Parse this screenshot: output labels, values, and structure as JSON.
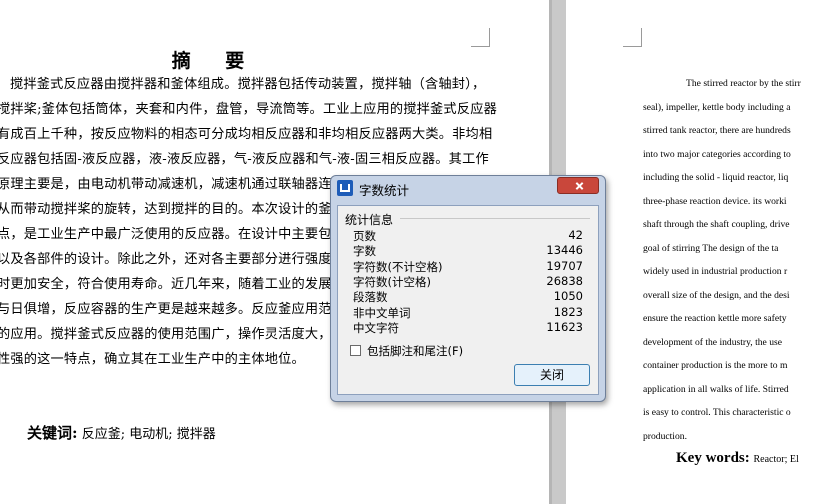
{
  "cn_page": {
    "title": "摘 要",
    "lines": [
      "搅拌釜式反应器由搅拌器和釜体组成。搅拌器包括传动装置，搅拌轴（含轴封），",
      "搅拌桨;釜体包括筒体，夹套和内件，盘管，导流筒等。工业上应用的搅拌釜式反应器",
      "有成百上千种，按反应物料的相态可分成均相反应器和非均相反应器两大类。非均相",
      "反应器包括固-液反应器，液-液反应器，气-液反应器和气-液-固三相反应器。其工作",
      "原理主要是，由电动机带动减速机，减速机通过联轴器连接搅",
      "从而带动搅拌桨的旋转，达到搅拌的目的。本次设计的釜式",
      "点，是工业生产中最广泛使用的反应器。在设计中主要包括对",
      "以及各部件的设计。除此之外，还对各主要部分进行强度校核",
      "时更加安全，符合使用寿命。近几年来，随着工业的发展，化",
      "与日俱增，反应容器的生产更是越来越多。反应釜应用范围较",
      "的应用。搅拌釜式反应器的使用范围广，操作灵活度大，浓",
      "性强的这一特点，确立其在工业生产中的主体地位。"
    ],
    "keywords_label": "关键词:",
    "keywords": "反应釜;  电动机;  搅拌器"
  },
  "en_page": {
    "lines": [
      "The stirred reactor by the stirr",
      "seal), impeller, kettle body including a",
      "stirred tank reactor, there are hundreds",
      "into two major categories according to",
      "including the solid - liquid reactor, liq",
      "three-phase reaction device.   its worki",
      "shaft through the shaft coupling, drive",
      "goal of stirring    The design of the ta",
      "widely used in industrial production r",
      "overall size of the design, and the desi",
      "ensure the reaction kettle more safety",
      "development of the industry, the use",
      "container production is the more to m",
      "application in all walks of life. Stirred",
      "is easy to control. This characteristic o",
      "production."
    ],
    "keywords_label": "Key words:",
    "keywords": "Reactor; El"
  },
  "dialog": {
    "title": "字数统计",
    "section_label": "统计信息",
    "stats": [
      {
        "label": "页数",
        "value": "42"
      },
      {
        "label": "字数",
        "value": "13446"
      },
      {
        "label": "字符数(不计空格)",
        "value": "19707"
      },
      {
        "label": "字符数(计空格)",
        "value": "26838"
      },
      {
        "label": "段落数",
        "value": "1050"
      },
      {
        "label": "非中文单词",
        "value": "1823"
      },
      {
        "label": "中文字符",
        "value": "11623"
      }
    ],
    "checkbox_label": "包括脚注和尾注(F)",
    "close_button": "关闭",
    "colors": {
      "titlebar": "#c6d3e6",
      "close": "#c9473b",
      "icon": "#1d5cb8"
    }
  }
}
